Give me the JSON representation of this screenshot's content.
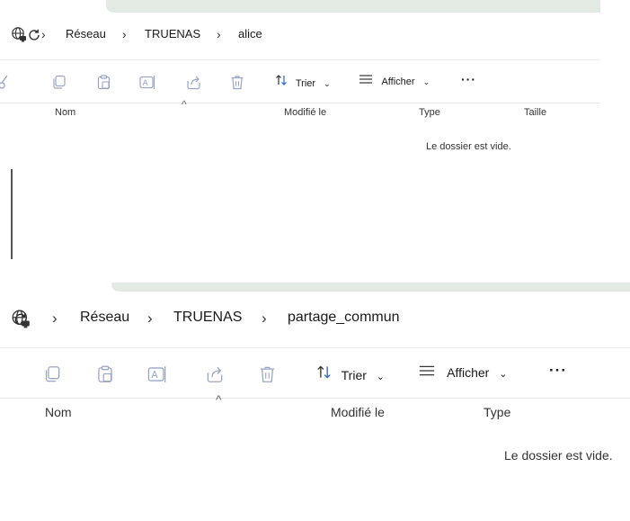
{
  "window1": {
    "breadcrumb": [
      "Réseau",
      "TRUENAS",
      "alice"
    ],
    "toolbar": {
      "sort_label": "Trier",
      "view_label": "Afficher",
      "more_label": "···"
    },
    "columns": [
      "Nom",
      "Modifié le",
      "Type",
      "Taille"
    ],
    "empty_message": "Le dossier est vide."
  },
  "window2": {
    "breadcrumb": [
      "Réseau",
      "TRUENAS",
      "partage_commun"
    ],
    "toolbar": {
      "sort_label": "Trier",
      "view_label": "Afficher",
      "more_label": "···"
    },
    "columns": [
      "Nom",
      "Modifié le",
      "Type"
    ],
    "empty_message": "Le dossier est vide."
  },
  "icons": {
    "refresh": "refresh-icon",
    "network": "network-globe-icon",
    "chevron": "chevron-right-icon",
    "cut": "cut-icon",
    "copy": "copy-icon",
    "paste": "paste-icon",
    "rename": "rename-icon",
    "share": "share-icon",
    "delete": "delete-icon",
    "sort": "sort-icon",
    "view": "view-icon",
    "more": "more-icon"
  },
  "colors": {
    "disabled_icon": "#9aa6c8",
    "tabstrip": "#e3e9e3",
    "address_bg": "#f6f6f6"
  }
}
